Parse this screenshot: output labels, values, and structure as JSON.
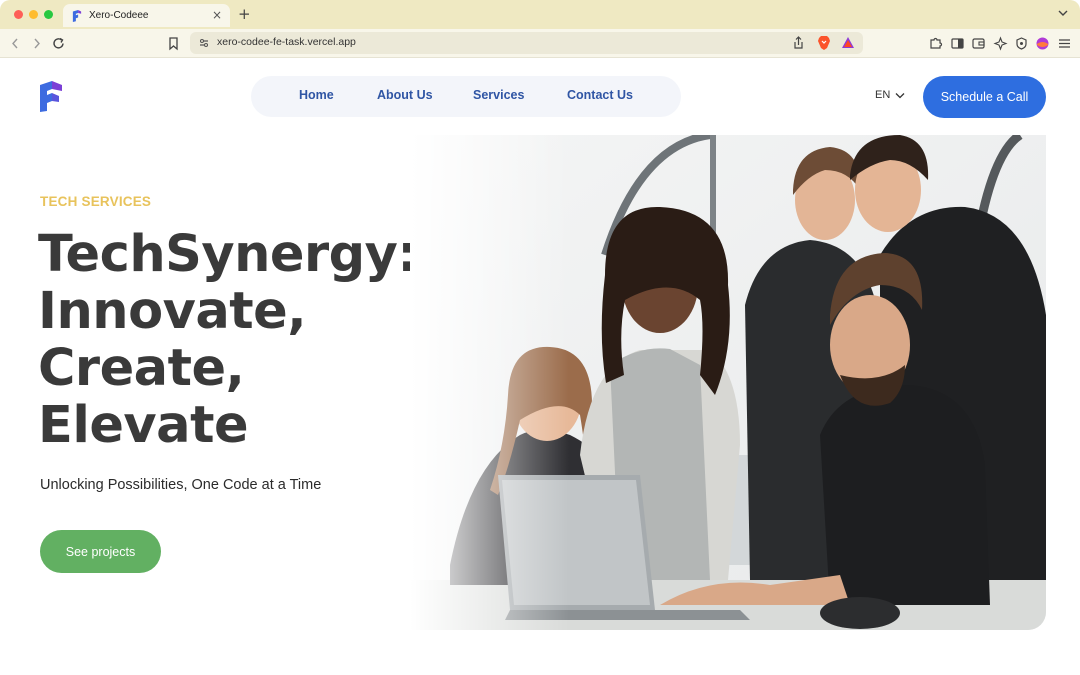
{
  "browser": {
    "tab_title": "Xero-Codeee",
    "tab_close": "×",
    "new_tab": "+",
    "url": "xero-codee-fe-task.vercel.app"
  },
  "nav": {
    "items": [
      {
        "label": "Home"
      },
      {
        "label": "About Us"
      },
      {
        "label": "Services"
      },
      {
        "label": "Contact Us"
      }
    ]
  },
  "header": {
    "language": "EN",
    "cta_label": "Schedule a Call"
  },
  "hero": {
    "eyebrow": "TECH SERVICES",
    "headline_lines": [
      "TechSynergy:",
      "Innovate,",
      "Create,",
      "Elevate"
    ],
    "subtitle": "Unlocking Possibilities, One Code at a Time",
    "button_label": "See projects",
    "image_icon": "team-photo"
  },
  "colors": {
    "tabstrip": "#efe9c2",
    "nav_link": "#2f55a4",
    "cta_blue": "#2e6ee0",
    "eyebrow_gold": "#e8c35c",
    "button_green": "#62b062",
    "logo_blue": "#3d6be0",
    "logo_purple": "#7b3fd6"
  }
}
